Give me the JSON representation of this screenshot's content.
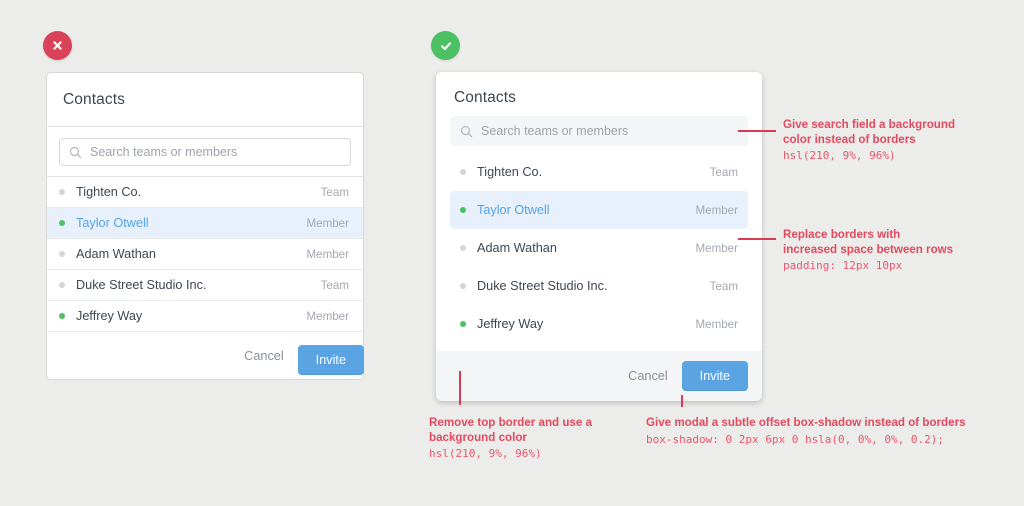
{
  "page": {
    "background_color": "#ececeb"
  },
  "badges": {
    "bad": {
      "icon": "close-icon",
      "color": "#d9435a",
      "meaning": "dont"
    },
    "good": {
      "icon": "check-icon",
      "color": "#4cc163",
      "meaning": "do"
    }
  },
  "modal_bad": {
    "title": "Contacts",
    "search": {
      "icon": "search-icon",
      "placeholder": "Search teams or members",
      "value": ""
    },
    "rows": [
      {
        "name": "Tighten Co.",
        "meta": "Team",
        "status": "offline",
        "selected": false
      },
      {
        "name": "Taylor Otwell",
        "meta": "Member",
        "status": "online",
        "selected": true
      },
      {
        "name": "Adam Wathan",
        "meta": "Member",
        "status": "offline",
        "selected": false
      },
      {
        "name": "Duke Street Studio Inc.",
        "meta": "Team",
        "status": "offline",
        "selected": false
      },
      {
        "name": "Jeffrey Way",
        "meta": "Member",
        "status": "online",
        "selected": false
      }
    ],
    "footer": {
      "cancel_label": "Cancel",
      "invite_label": "Invite"
    }
  },
  "modal_good": {
    "title": "Contacts",
    "search": {
      "icon": "search-icon",
      "placeholder": "Search teams or members",
      "value": ""
    },
    "rows": [
      {
        "name": "Tighten Co.",
        "meta": "Team",
        "status": "offline",
        "selected": false
      },
      {
        "name": "Taylor Otwell",
        "meta": "Member",
        "status": "online",
        "selected": true
      },
      {
        "name": "Adam Wathan",
        "meta": "Member",
        "status": "offline",
        "selected": false
      },
      {
        "name": "Duke Street Studio Inc.",
        "meta": "Team",
        "status": "offline",
        "selected": false
      },
      {
        "name": "Jeffrey Way",
        "meta": "Member",
        "status": "online",
        "selected": false
      }
    ],
    "footer": {
      "cancel_label": "Cancel",
      "invite_label": "Invite"
    }
  },
  "annotations": {
    "search": {
      "text": "Give search field a background\ncolor instead of borders",
      "code": "hsl(210, 9%, 96%)"
    },
    "rows": {
      "text": "Replace borders with\nincreased space between rows",
      "code": "padding: 12px 10px"
    },
    "footer": {
      "text": "Remove top border and use a\nbackground color",
      "code": "hsl(210, 9%, 96%)"
    },
    "shadow": {
      "text": "Give modal a subtle offset box-shadow instead of borders",
      "code": "box-shadow: 0 2px 6px 0 hsla(0, 0%, 0%, 0.2);"
    }
  },
  "colors": {
    "accent_blue": "#5ba4e4",
    "annotation_red": "#e24a5e",
    "status_online": "#4cc163",
    "status_offline": "#d3d6d9",
    "panel_gray": "hsl(210, 9%, 96%)"
  }
}
